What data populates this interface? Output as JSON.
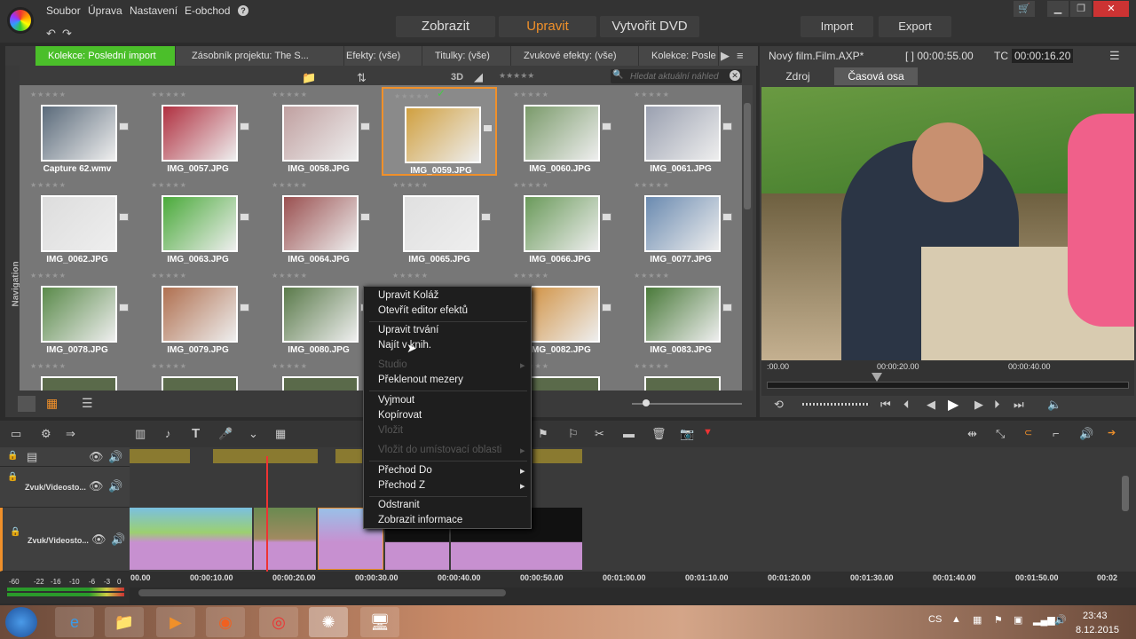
{
  "menu": {
    "file": "Soubor",
    "edit": "Úprava",
    "settings": "Nastavení",
    "eshop": "E-obchod",
    "help": "?"
  },
  "modes": {
    "view": "Zobrazit",
    "edit": "Upravit",
    "dvd": "Vytvořit DVD",
    "import": "Import",
    "export": "Export"
  },
  "tabs": [
    "Kolekce: Poslední import",
    "Zásobník projektu: The S...",
    "Efekty: (vše)",
    "Titulky: (vše)",
    "Zvukové efekty: (vše)",
    "Kolekce: Posle"
  ],
  "library": {
    "nav_label": "Navigation",
    "mode_3d": "3D",
    "search_placeholder": "Hledat aktuální náhled"
  },
  "thumbs": [
    {
      "label": "Capture 62.wmv"
    },
    {
      "label": "IMG_0057.JPG"
    },
    {
      "label": "IMG_0058.JPG"
    },
    {
      "label": "IMG_0059.JPG",
      "selected": true
    },
    {
      "label": "IMG_0060.JPG"
    },
    {
      "label": "IMG_0061.JPG"
    },
    {
      "label": "IMG_0062.JPG"
    },
    {
      "label": "IMG_0063.JPG"
    },
    {
      "label": "IMG_0064.JPG"
    },
    {
      "label": "IMG_0065.JPG"
    },
    {
      "label": "IMG_0066.JPG"
    },
    {
      "label": "IMG_0077.JPG"
    },
    {
      "label": "IMG_0078.JPG"
    },
    {
      "label": "IMG_0079.JPG"
    },
    {
      "label": "IMG_0080.JPG"
    },
    {
      "label": ""
    },
    {
      "label": "IMG_0082.JPG"
    },
    {
      "label": "IMG_0083.JPG"
    }
  ],
  "preview": {
    "title": "Nový film.Film.AXP*",
    "duration": "[ ] 00:00:55.00",
    "tc_label": "TC",
    "tc": "00:00:16.20",
    "tab_source": "Zdroj",
    "tab_timeline": "Časová osa",
    "t0": ":00.00",
    "t1": "00:00:20.00",
    "t2": "00:00:40.00"
  },
  "tracks": {
    "track1": "Zvuk/Videostо...",
    "track2": "Zvuk/Videostо..."
  },
  "ruler": [
    "00.00",
    "00:00:10.00",
    "00:00:20.00",
    "00:00:30.00",
    "00:00:40.00",
    "00:00:50.00",
    "00:01:00.00",
    "00:01:10.00",
    "00:01:20.00",
    "00:01:30.00",
    "00:01:40.00",
    "00:01:50.00",
    "00:02"
  ],
  "meter": [
    "-60",
    "-22",
    "-16",
    "-10",
    "-6",
    "-3",
    "0"
  ],
  "context_menu": {
    "edit_collage": "Upravit Koláž",
    "open_effects": "Otevřít editor efektů",
    "edit_duration": "Upravit trvání",
    "find_in_library": "Najít v knih.",
    "studio": "Studio",
    "overlap_gaps": "Překlenout mezery",
    "cut": "Vyjmout",
    "copy": "Kopírovat",
    "paste": "Vložit",
    "paste_at_placeholder": "Vložit do umístovací oblasti",
    "transition_to": "Přechod Do",
    "transition_from": "Přechod Z",
    "delete": "Odstranit",
    "show_info": "Zobrazit informace"
  },
  "taskbar": {
    "lang": "CS",
    "time": "23:43",
    "date": "8.12.2015"
  }
}
